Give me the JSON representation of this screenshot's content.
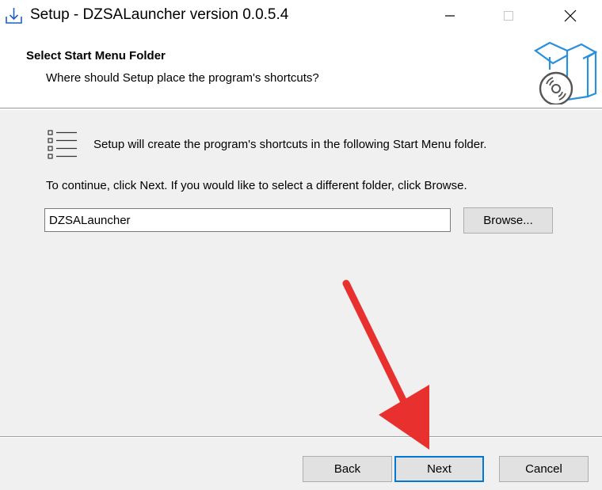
{
  "window": {
    "title": "Setup - DZSALauncher version 0.0.5.4"
  },
  "header": {
    "heading": "Select Start Menu Folder",
    "subheading": "Where should Setup place the program's shortcuts?"
  },
  "content": {
    "intro": "Setup will create the program's shortcuts in the following Start Menu folder.",
    "instruction": "To continue, click Next. If you would like to select a different folder, click Browse.",
    "folder_value": "DZSALauncher",
    "browse_label": "Browse..."
  },
  "footer": {
    "back_label": "Back",
    "next_label": "Next",
    "cancel_label": "Cancel"
  },
  "colors": {
    "accent": "#0078d7",
    "annotation_arrow": "#e8302e"
  }
}
